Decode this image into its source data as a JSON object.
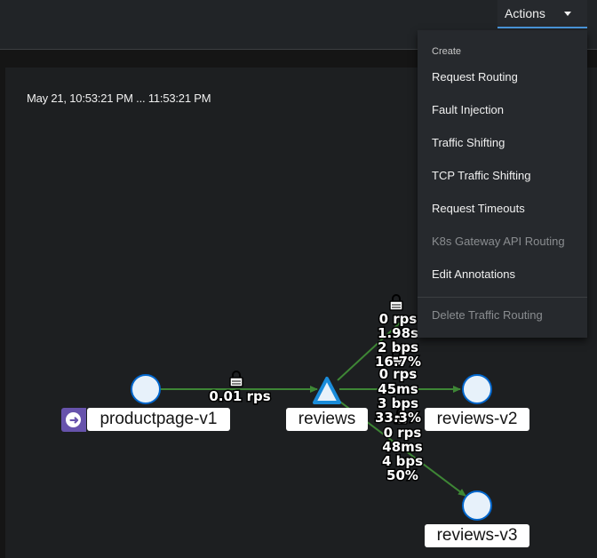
{
  "toolbar": {
    "actions_label": "Actions"
  },
  "graph": {
    "time_range": "May 21, 10:53:21 PM ... 11:53:21 PM",
    "nodes": {
      "productpage": "productpage-v1",
      "reviews": "reviews",
      "reviews_v2": "reviews-v2",
      "reviews_v3": "reviews-v3"
    },
    "edges": {
      "productpage_to_reviews": [
        "0.01 rps"
      ],
      "reviews_to_v1": [
        "0 rps",
        "1.98s",
        "2 bps",
        "16.7%"
      ],
      "reviews_to_v2": [
        "0 rps",
        "45ms",
        "3 bps",
        "33.3%"
      ],
      "reviews_to_v3": [
        "0 rps",
        "48ms",
        "4 bps",
        "50%"
      ]
    },
    "colors": {
      "edge": "#3e8635",
      "node_fill": "#e7f1fa",
      "node_stroke": "#0066cc",
      "triangle_fill": "#e7f1fa",
      "app_badge": "#6753ac"
    }
  },
  "menu": {
    "group_label": "Create",
    "items": [
      {
        "label": "Request Routing",
        "disabled": false
      },
      {
        "label": "Fault Injection",
        "disabled": false
      },
      {
        "label": "Traffic Shifting",
        "disabled": false
      },
      {
        "label": "TCP Traffic Shifting",
        "disabled": false
      },
      {
        "label": "Request Timeouts",
        "disabled": false
      },
      {
        "label": "K8s Gateway API Routing",
        "disabled": true
      },
      {
        "label": "Edit Annotations",
        "disabled": false
      }
    ],
    "delete_label": "Delete Traffic Routing"
  },
  "icons": {
    "actions_caret": "caret-down-icon",
    "lock": "lock-icon",
    "app": "arrow-right-circle-icon"
  }
}
